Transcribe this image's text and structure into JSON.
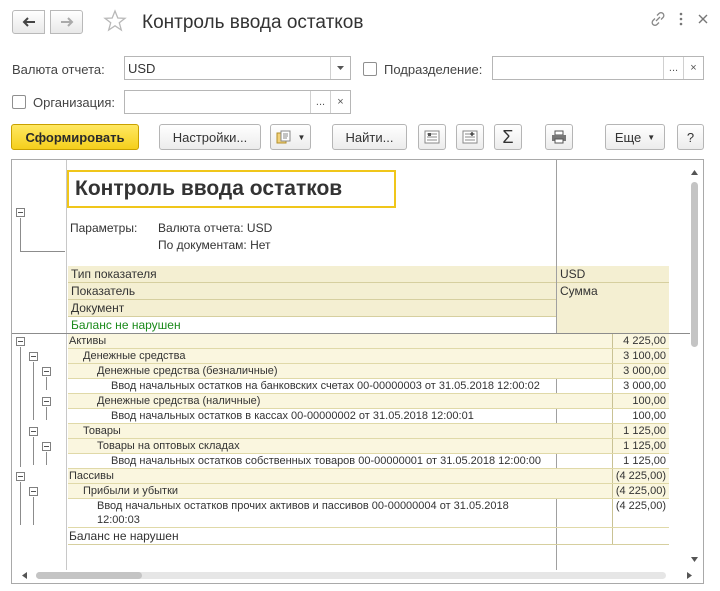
{
  "window": {
    "title": "Контроль ввода остатков"
  },
  "form": {
    "currency_label": "Валюта отчета:",
    "currency_value": "USD",
    "division_label": "Подразделение:",
    "division_value": "",
    "organization_label": "Организация:",
    "organization_value": "",
    "ellipsis": "...",
    "clear": "×"
  },
  "toolbar": {
    "generate": "Сформировать",
    "settings": "Настройки...",
    "find": "Найти...",
    "sum": "Σ",
    "more": "Еще",
    "help": "?"
  },
  "report": {
    "title": "Контроль ввода остатков",
    "params_label": "Параметры:",
    "param1": "Валюта отчета: USD",
    "param2": "По документам: Нет",
    "header": {
      "type": "Тип показателя",
      "indicator": "Показатель",
      "document": "Документ",
      "balance_ok": "Баланс не нарушен",
      "currency": "USD",
      "sum": "Сумма"
    },
    "rows": [
      {
        "name": "Активы",
        "value": "4 225,00"
      },
      {
        "name": "Денежные средства",
        "value": "3 100,00"
      },
      {
        "name": "Денежные средства (безналичные)",
        "value": "3 000,00"
      },
      {
        "name": "Ввод начальных остатков на банковских счетах 00-00000003 от 31.05.2018 12:00:02",
        "value": "3 000,00"
      },
      {
        "name": "Денежные средства (наличные)",
        "value": "100,00"
      },
      {
        "name": "Ввод начальных остатков в кассах 00-00000002 от 31.05.2018 12:00:01",
        "value": "100,00"
      },
      {
        "name": "Товары",
        "value": "1 125,00"
      },
      {
        "name": "Товары на оптовых складах",
        "value": "1 125,00"
      },
      {
        "name": "Ввод начальных остатков собственных товаров 00-00000001 от 31.05.2018 12:00:00",
        "value": "1 125,00"
      },
      {
        "name": "Пассивы",
        "value": "(4 225,00)"
      },
      {
        "name": "Прибыли и убытки",
        "value": "(4 225,00)"
      },
      {
        "name": "Ввод начальных остатков прочих активов и пассивов 00-00000004 от 31.05.2018",
        "name2": "12:00:03",
        "value": "(4 225,00)"
      }
    ],
    "footer_balance": "Баланс не нарушен"
  }
}
